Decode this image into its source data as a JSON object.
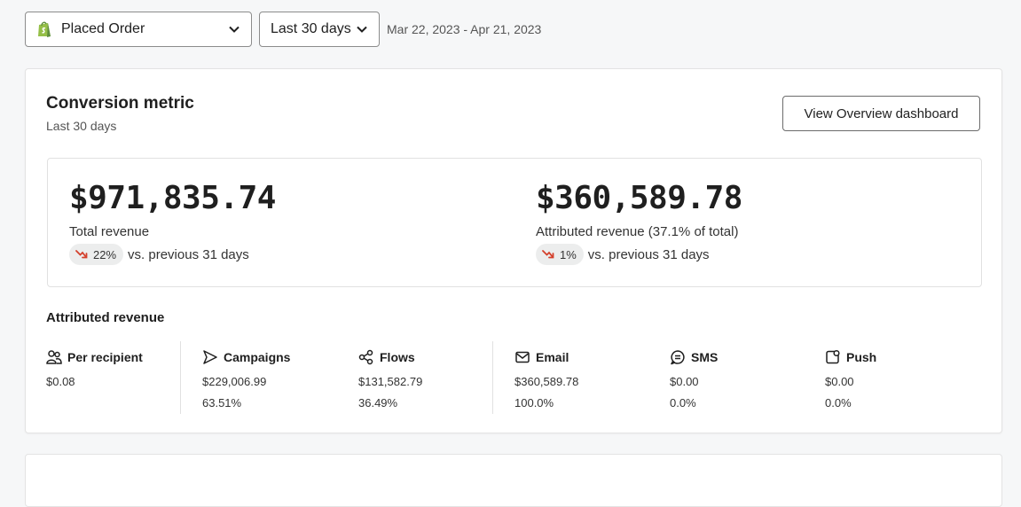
{
  "filters": {
    "metric": "Placed Order",
    "range": "Last 30 days",
    "date_range": "Mar 22, 2023 - Apr 21, 2023"
  },
  "card": {
    "title": "Conversion metric",
    "subtitle": "Last 30 days",
    "overview_button": "View Overview dashboard"
  },
  "revenue": {
    "total": {
      "amount": "$971,835.74",
      "label": "Total revenue",
      "change": "22%",
      "trend": "down",
      "comparison": "vs. previous 31 days"
    },
    "attributed": {
      "amount": "$360,589.78",
      "label": "Attributed revenue (37.1% of total)",
      "change": "1%",
      "trend": "down",
      "comparison": "vs. previous 31 days"
    }
  },
  "attributed_section": {
    "title": "Attributed revenue",
    "columns": [
      {
        "name": "Per recipient",
        "icon": "people-icon",
        "value": "$0.08",
        "percent": ""
      },
      {
        "name": "Campaigns",
        "icon": "send-icon",
        "value": "$229,006.99",
        "percent": "63.51%"
      },
      {
        "name": "Flows",
        "icon": "flow-icon",
        "value": "$131,582.79",
        "percent": "36.49%"
      },
      {
        "name": "Email",
        "icon": "mail-icon",
        "value": "$360,589.78",
        "percent": "100.0%"
      },
      {
        "name": "SMS",
        "icon": "sms-icon",
        "value": "$0.00",
        "percent": "0.0%"
      },
      {
        "name": "Push",
        "icon": "push-icon",
        "value": "$0.00",
        "percent": "0.0%"
      }
    ]
  },
  "colors": {
    "trend_down": "#d4402c",
    "shopify_green": "#5e8e3e"
  }
}
